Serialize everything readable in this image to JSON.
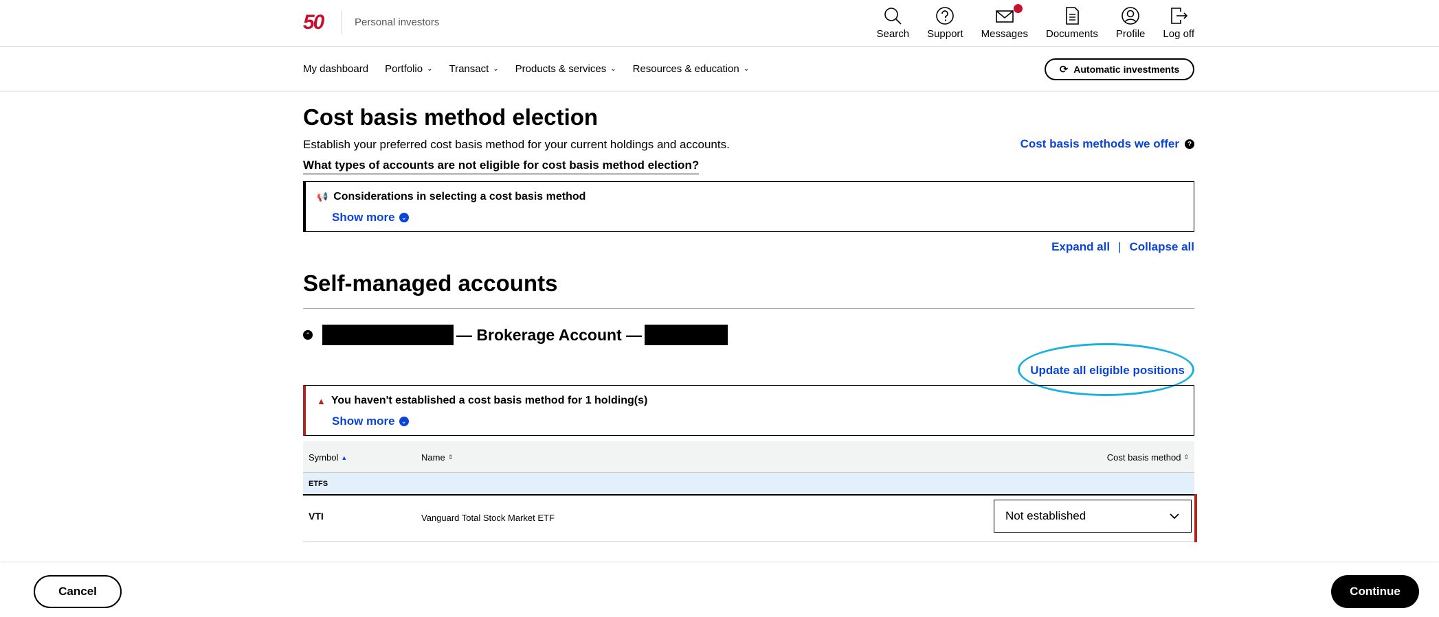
{
  "header": {
    "logo_text": "50",
    "brand_sub": "Personal investors",
    "icons": [
      {
        "name": "search",
        "label": "Search"
      },
      {
        "name": "support",
        "label": "Support"
      },
      {
        "name": "messages",
        "label": "Messages"
      },
      {
        "name": "documents",
        "label": "Documents"
      },
      {
        "name": "profile",
        "label": "Profile"
      },
      {
        "name": "logoff",
        "label": "Log off"
      }
    ]
  },
  "nav": {
    "items": [
      {
        "label": "My dashboard"
      },
      {
        "label": "Portfolio"
      },
      {
        "label": "Transact"
      },
      {
        "label": "Products & services"
      },
      {
        "label": "Resources & education"
      }
    ],
    "auto_label": "Automatic investments"
  },
  "page": {
    "title": "Cost basis method election",
    "description": "Establish your preferred cost basis method for your current holdings and accounts.",
    "eligibility_link": "What types of accounts are not eligible for cost basis method election?",
    "methods_link": "Cost basis methods we offer",
    "considerations_title": "Considerations in selecting a cost basis method",
    "show_more": "Show more",
    "expand_all": "Expand all",
    "separator": "|",
    "collapse_all": "Collapse all"
  },
  "section": {
    "title": "Self-managed accounts",
    "account_label": "— Brokerage Account —",
    "update_link": "Update all eligible positions",
    "warning_title": "You haven't established a cost basis method for 1 holding(s)",
    "show_more": "Show more"
  },
  "table": {
    "headers": {
      "symbol": "Symbol",
      "name": "Name",
      "cost_basis": "Cost basis method"
    },
    "group": "ETFS",
    "rows": [
      {
        "symbol": "VTI",
        "name": "Vanguard Total Stock Market ETF",
        "method": "Not established"
      }
    ]
  },
  "footer": {
    "cancel": "Cancel",
    "continue": "Continue"
  },
  "colors": {
    "link": "#0a45d8",
    "brand_red": "#c8102e",
    "highlight": "#1bb0de",
    "warning": "#b3261e"
  }
}
